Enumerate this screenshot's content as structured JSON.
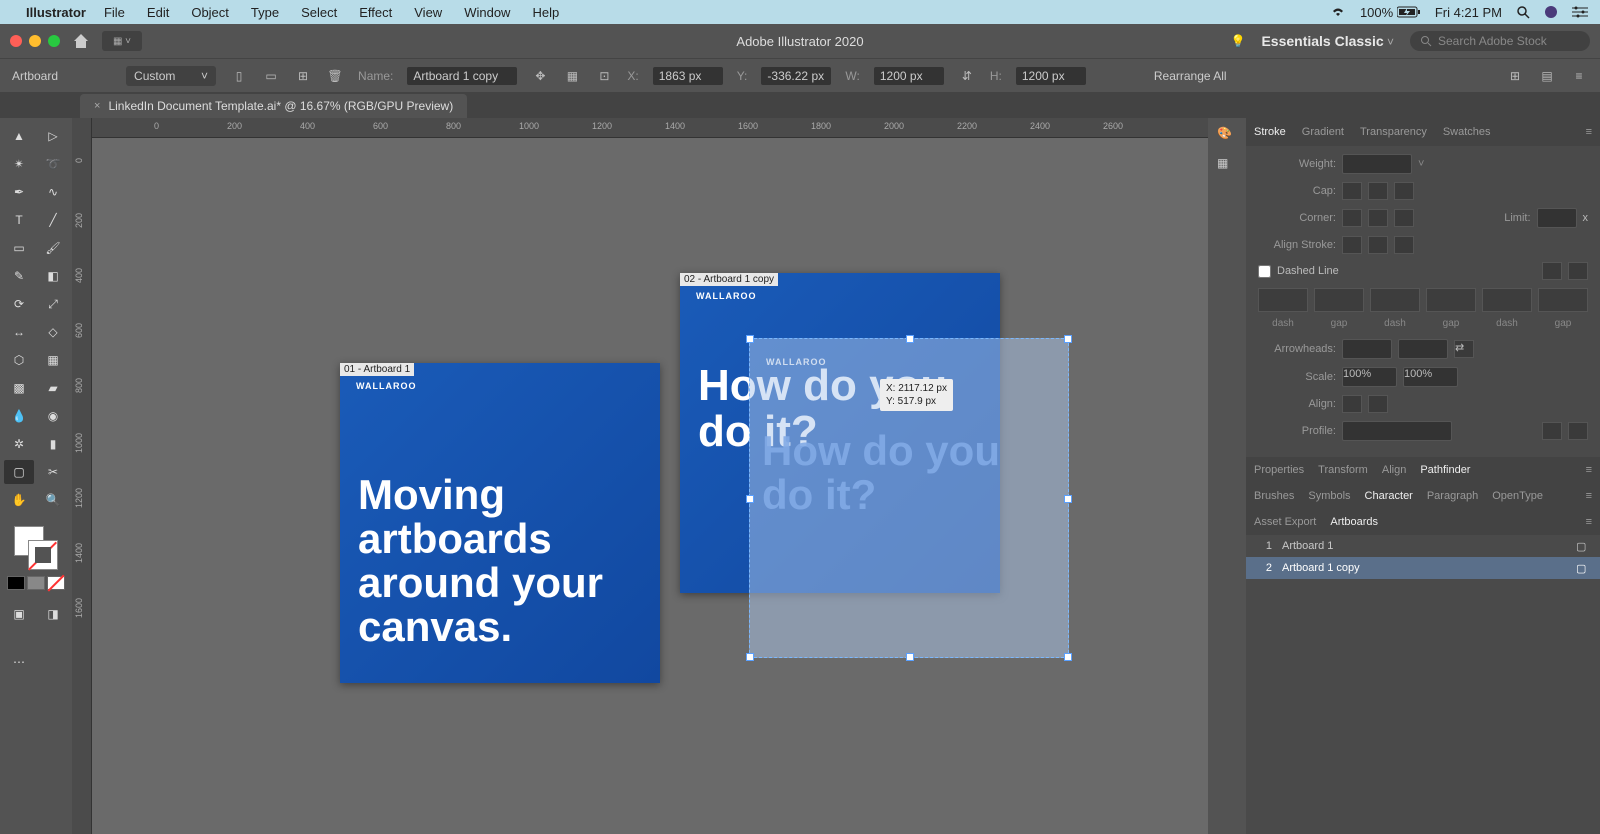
{
  "menubar": {
    "app": "Illustrator",
    "items": [
      "File",
      "Edit",
      "Object",
      "Type",
      "Select",
      "Effect",
      "View",
      "Window",
      "Help"
    ],
    "battery": "100%",
    "clock": "Fri 4:21 PM"
  },
  "titlebar": {
    "app_title": "Adobe Illustrator 2020",
    "workspace": "Essentials Classic",
    "search_placeholder": "Search Adobe Stock"
  },
  "controlbar": {
    "doc_label": "Artboard",
    "preset": "Custom",
    "name_label": "Name:",
    "name_value": "Artboard 1 copy",
    "x_label": "X:",
    "x_value": "1863 px",
    "y_label": "Y:",
    "y_value": "-336.22 px",
    "w_label": "W:",
    "w_value": "1200 px",
    "h_label": "H:",
    "h_value": "1200 px",
    "rearrange": "Rearrange All"
  },
  "doc_tab": "LinkedIn Document Template.ai* @ 16.67% (RGB/GPU Preview)",
  "hruler_ticks": [
    "0",
    "200",
    "400",
    "600",
    "800",
    "1000",
    "1200",
    "1400",
    "1600",
    "1800",
    "2000",
    "2200",
    "2400",
    "2600"
  ],
  "vruler_ticks": [
    "0",
    "200",
    "400",
    "600",
    "800",
    "1000",
    "1200",
    "1400",
    "1600"
  ],
  "artboard1": {
    "label": "01 - Artboard 1",
    "brand": "WALLAROO",
    "headline": "Moving artboards around your canvas."
  },
  "artboard2": {
    "label": "02 - Artboard 1 copy",
    "brand": "WALLAROO",
    "headline": "How do you do it?"
  },
  "ghost": {
    "brand": "WALLAROO",
    "headline": "How do you do it?",
    "tooltip_x": "X: 2117.12 px",
    "tooltip_y": "Y: 517.9 px"
  },
  "panels": {
    "stroke_tabs": [
      "Stroke",
      "Gradient",
      "Transparency",
      "Swatches"
    ],
    "weight": "Weight:",
    "cap": "Cap:",
    "corner": "Corner:",
    "limit": "Limit:",
    "limit_x": "x",
    "align_stroke": "Align Stroke:",
    "dashed": "Dashed Line",
    "dash_labels": [
      "dash",
      "gap",
      "dash",
      "gap",
      "dash",
      "gap"
    ],
    "arrowheads": "Arrowheads:",
    "scale": "Scale:",
    "scale_val": "100%",
    "align": "Align:",
    "profile": "Profile:",
    "row2": [
      "Properties",
      "Transform",
      "Align",
      "Pathfinder"
    ],
    "row3": [
      "Brushes",
      "Symbols",
      "Character",
      "Paragraph",
      "OpenType"
    ],
    "row4": [
      "Asset Export",
      "Artboards"
    ],
    "artboards": [
      {
        "num": "1",
        "name": "Artboard 1"
      },
      {
        "num": "2",
        "name": "Artboard 1 copy"
      }
    ]
  }
}
